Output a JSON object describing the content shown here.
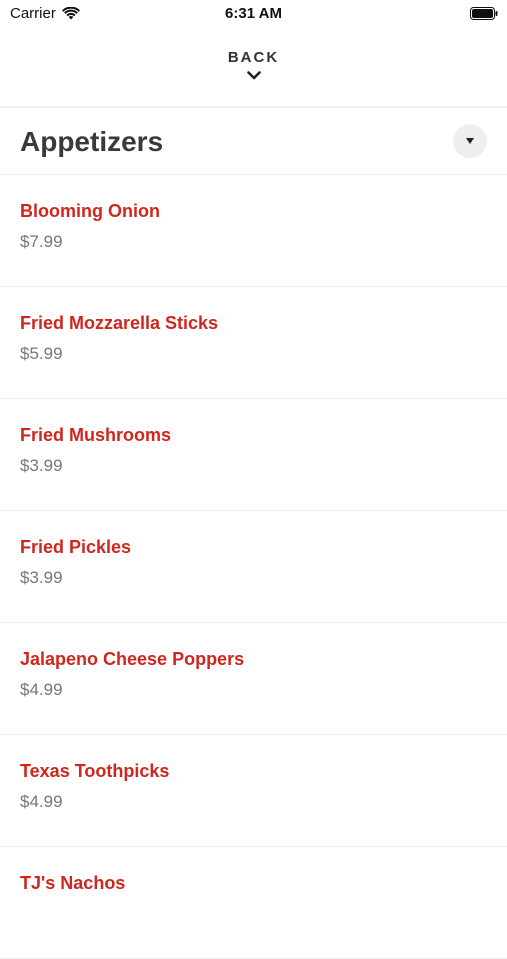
{
  "status_bar": {
    "carrier": "Carrier",
    "time": "6:31 AM",
    "wifi_icon": "wifi-icon",
    "battery_icon": "battery-icon"
  },
  "nav": {
    "back_label": "BACK",
    "back_icon": "chevron-down-icon"
  },
  "category": {
    "title": "Appetizers",
    "dropdown_icon": "caret-down-icon"
  },
  "colors": {
    "item_name": "#d0261d",
    "price": "#777777",
    "title": "#3a3a3a",
    "divider": "#eeeeee",
    "dropdown_bg": "#efefef"
  },
  "items": [
    {
      "name": "Blooming Onion",
      "price": "$7.99"
    },
    {
      "name": "Fried Mozzarella Sticks",
      "price": "$5.99"
    },
    {
      "name": "Fried Mushrooms",
      "price": "$3.99"
    },
    {
      "name": "Fried Pickles",
      "price": "$3.99"
    },
    {
      "name": "Jalapeno Cheese Poppers",
      "price": "$4.99"
    },
    {
      "name": "Texas Toothpicks",
      "price": "$4.99"
    },
    {
      "name": "TJ's Nachos",
      "price": ""
    }
  ]
}
